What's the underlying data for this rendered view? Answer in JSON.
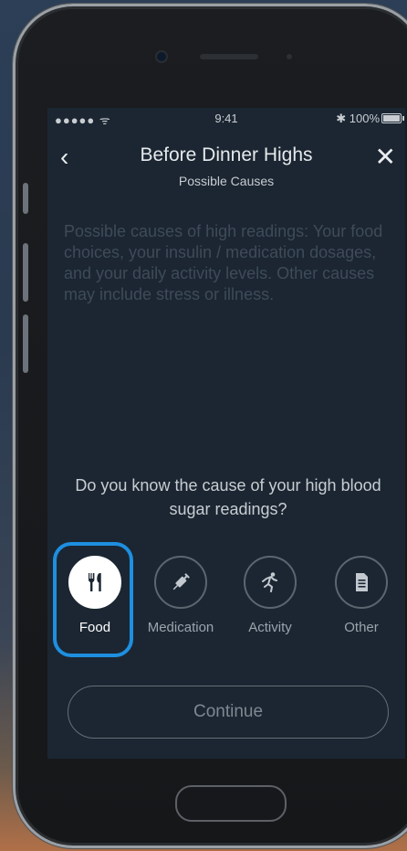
{
  "status_bar": {
    "signal": "●●●●● ",
    "wifi": "ᯤ",
    "time": "9:41",
    "bluetooth": "✱",
    "battery_text": "100%",
    "battery_level": 1.0
  },
  "header": {
    "title": "Before Dinner Highs",
    "subtitle": "Possible Causes",
    "back_glyph": "‹",
    "close_glyph": "✕"
  },
  "description": "Possible causes of high readings: Your food choices, your insulin / medication dosages, and your daily activity levels. Other causes may include stress or illness.",
  "question": "Do you know the cause of your high blood sugar readings?",
  "causes": [
    {
      "label": "Food",
      "icon": "fork-knife-icon",
      "selected": true
    },
    {
      "label": "Medication",
      "icon": "syringe-icon",
      "selected": false
    },
    {
      "label": "Activity",
      "icon": "running-person-icon",
      "selected": false
    },
    {
      "label": "Other",
      "icon": "document-icon",
      "selected": false
    }
  ],
  "continue_label": "Continue",
  "colors": {
    "highlight": "#1e8fe0",
    "screen_bg": "#1b2632"
  }
}
